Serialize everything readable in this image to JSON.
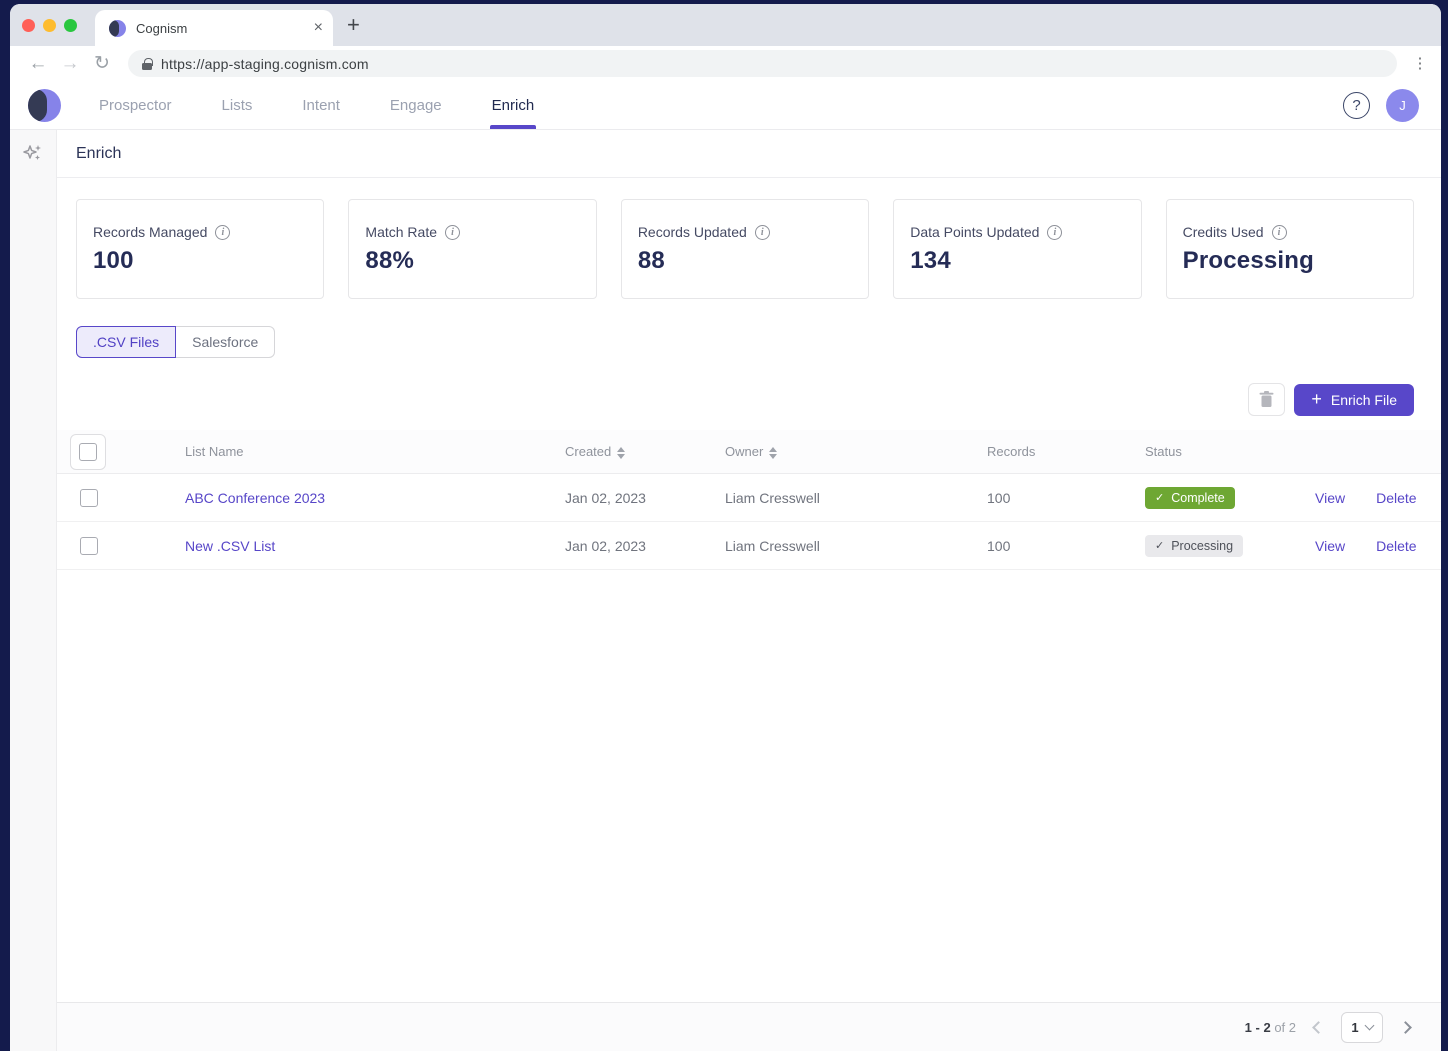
{
  "browser": {
    "tab_title": "Cognism",
    "close_glyph": "×",
    "new_tab_glyph": "+",
    "back_glyph": "←",
    "forward_glyph": "→",
    "reload_glyph": "↻",
    "url": "https://app-staging.cognism.com",
    "kebab_glyph": "⋮"
  },
  "nav": {
    "items": [
      {
        "label": "Prospector",
        "active": false
      },
      {
        "label": "Lists",
        "active": false
      },
      {
        "label": "Intent",
        "active": false
      },
      {
        "label": "Engage",
        "active": false
      },
      {
        "label": "Enrich",
        "active": true
      }
    ],
    "help_glyph": "?",
    "avatar_initial": "J"
  },
  "page": {
    "title": "Enrich"
  },
  "stats": [
    {
      "label": "Records Managed",
      "value": "100"
    },
    {
      "label": "Match Rate",
      "value": "88%"
    },
    {
      "label": "Records Updated",
      "value": "88"
    },
    {
      "label": "Data Points Updated",
      "value": "134"
    },
    {
      "label": "Credits Used",
      "value": "Processing"
    }
  ],
  "info_glyph": "i",
  "source_tabs": [
    {
      "label": ".CSV Files",
      "active": true
    },
    {
      "label": "Salesforce",
      "active": false
    }
  ],
  "toolbar": {
    "plus_glyph": "+",
    "enrich_file_label": "Enrich File"
  },
  "table": {
    "columns": {
      "name": "List Name",
      "created": "Created",
      "owner": "Owner",
      "records": "Records",
      "status": "Status"
    },
    "rows": [
      {
        "name": "ABC Conference 2023",
        "created": "Jan 02, 2023",
        "owner": "Liam Cresswell",
        "records": "100",
        "status": "Complete",
        "status_tick": "✓"
      },
      {
        "name": "New .CSV List",
        "created": "Jan 02, 2023",
        "owner": "Liam Cresswell",
        "records": "100",
        "status": "Processing",
        "status_tick": "✓"
      }
    ],
    "row_actions": {
      "view": "View",
      "delete": "Delete"
    }
  },
  "pagination": {
    "range": "1 - 2",
    "of": "of 2",
    "page": "1"
  },
  "colors": {
    "accent": "#5847c9",
    "frame": "#141b4c",
    "complete_green": "#6ea733",
    "processing_gray": "#e9e9ec",
    "link": "#5746c8",
    "avatar_purple": "#8b89ec"
  }
}
